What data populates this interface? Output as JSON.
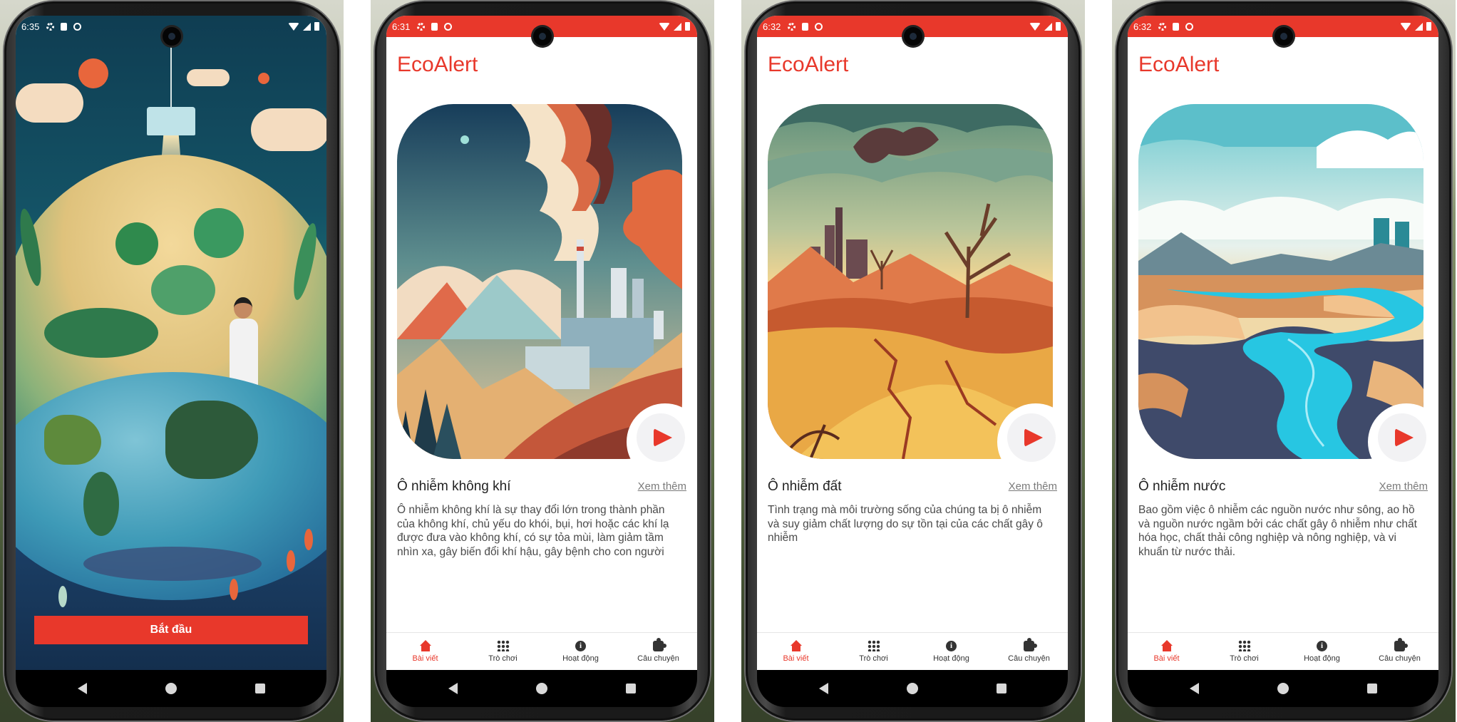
{
  "screens": [
    {
      "status_time": "6:35",
      "start_button": "Bắt đầu"
    },
    {
      "status_time": "6:31",
      "app_title": "EcoAlert",
      "article": {
        "title": "Ô nhiễm không khí",
        "see_more": "Xem thêm",
        "description": "Ô nhiễm không khí là sự thay đổi lớn trong thành phần của không khí, chủ yếu do khói, bụi, hơi hoặc các khí lạ được đưa vào không khí, có sự tỏa mùi, làm giảm tầm nhìn xa, gây biến đổi khí hậu, gây bệnh cho con người"
      }
    },
    {
      "status_time": "6:32",
      "app_title": "EcoAlert",
      "article": {
        "title": "Ô nhiễm đất",
        "see_more": "Xem thêm",
        "description": "Tình trạng mà môi trường sống của chúng ta bị ô nhiễm và suy giảm chất lượng do sự tồn tại của các chất gây ô nhiễm"
      }
    },
    {
      "status_time": "6:32",
      "app_title": "EcoAlert",
      "article": {
        "title": "Ô nhiễm nước",
        "see_more": "Xem thêm",
        "description": "Bao gồm việc ô nhiễm các nguồn nước như sông, ao hồ và nguồn nước ngầm bởi các chất gây ô nhiễm như chất hóa học, chất thải công nghiệp và nông nghiệp, và vi khuẩn từ nước thải."
      }
    }
  ],
  "tabs": [
    {
      "label": "Bài viết",
      "icon": "home-icon"
    },
    {
      "label": "Trò chơi",
      "icon": "grid-icon"
    },
    {
      "label": "Hoạt động",
      "icon": "info-icon"
    },
    {
      "label": "Câu chuyện",
      "icon": "puzzle-icon"
    }
  ],
  "colors": {
    "accent": "#e8382b",
    "background": "#ffffff",
    "text": "#222222",
    "muted": "#7a7a7a"
  }
}
